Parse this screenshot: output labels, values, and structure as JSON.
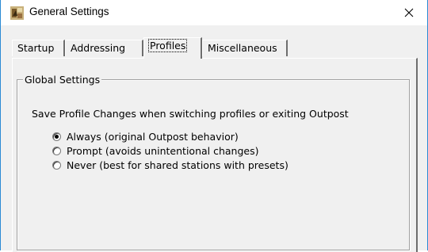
{
  "window": {
    "title": "General Settings",
    "close_glyph": "✕",
    "accent_color": "#2a8ad4"
  },
  "tabs": [
    {
      "label": "Startup",
      "selected": false
    },
    {
      "label": "Addressing",
      "selected": false
    },
    {
      "label": "Profiles",
      "selected": true
    },
    {
      "label": "Miscellaneous",
      "selected": false
    }
  ],
  "group": {
    "legend": "Global Settings",
    "description": "Save Profile Changes when switching profiles or exiting Outpost",
    "options": [
      {
        "label": "Always (original Outpost behavior)",
        "checked": true
      },
      {
        "label": "Prompt (avoids unintentional changes)",
        "checked": false
      },
      {
        "label": "Never (best for shared stations with presets)",
        "checked": false
      }
    ]
  },
  "icons": {
    "app_icon": "app-icon",
    "close_icon": "close-icon"
  }
}
